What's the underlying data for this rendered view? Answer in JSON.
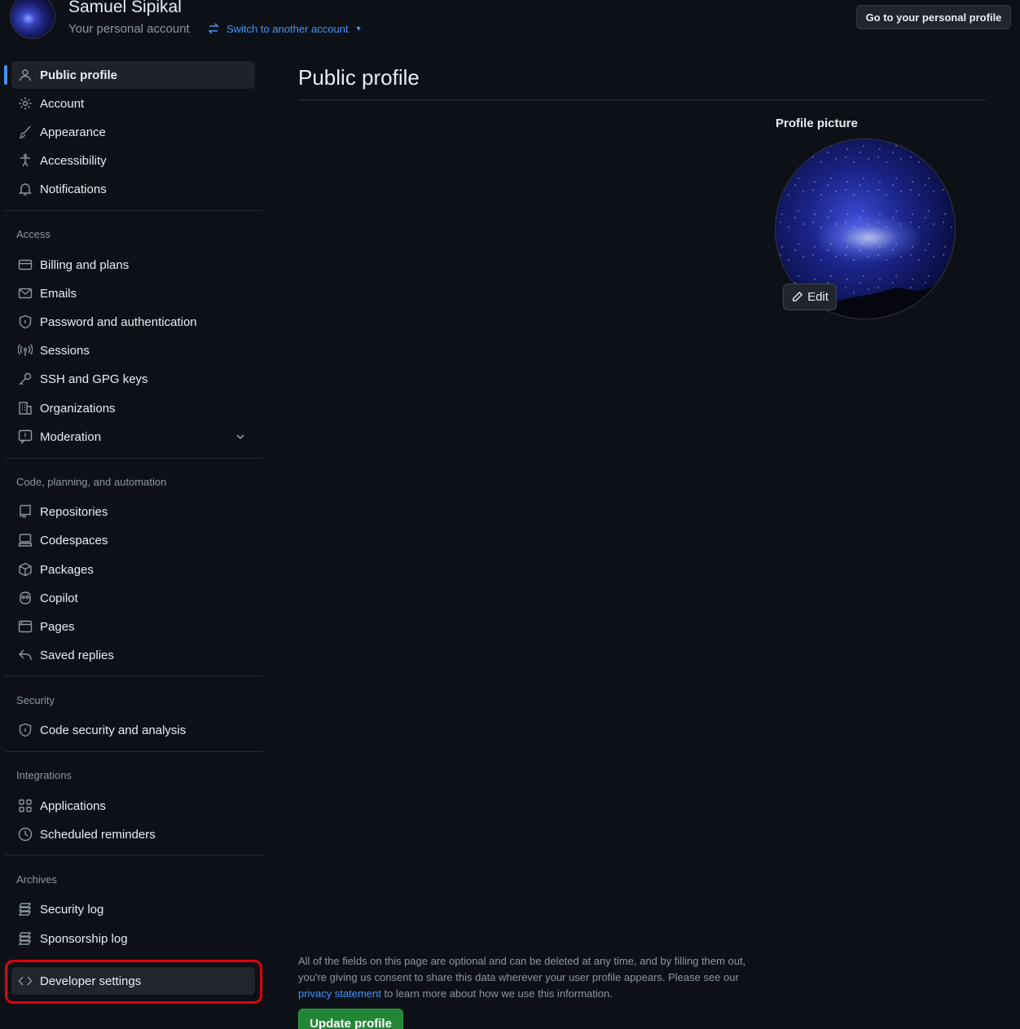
{
  "header": {
    "account_name": "Samuel Sipikal",
    "account_subtitle": "Your personal account",
    "switch_label": "Switch to another account",
    "go_profile_label": "Go to your personal profile"
  },
  "sidebar": {
    "top_items": [
      {
        "label": "Public profile",
        "icon": "person-icon",
        "active": true
      },
      {
        "label": "Account",
        "icon": "gear-icon"
      },
      {
        "label": "Appearance",
        "icon": "paintbrush-icon"
      },
      {
        "label": "Accessibility",
        "icon": "accessibility-icon"
      },
      {
        "label": "Notifications",
        "icon": "bell-icon"
      }
    ],
    "access_heading": "Access",
    "access_items": [
      {
        "label": "Billing and plans",
        "icon": "credit-card-icon"
      },
      {
        "label": "Emails",
        "icon": "mail-icon"
      },
      {
        "label": "Password and authentication",
        "icon": "shield-lock-icon"
      },
      {
        "label": "Sessions",
        "icon": "broadcast-icon"
      },
      {
        "label": "SSH and GPG keys",
        "icon": "key-icon"
      },
      {
        "label": "Organizations",
        "icon": "organization-icon"
      },
      {
        "label": "Moderation",
        "icon": "report-icon",
        "expandable": true
      }
    ],
    "code_heading": "Code, planning, and automation",
    "code_items": [
      {
        "label": "Repositories",
        "icon": "repo-icon"
      },
      {
        "label": "Codespaces",
        "icon": "codespaces-icon"
      },
      {
        "label": "Packages",
        "icon": "package-icon"
      },
      {
        "label": "Copilot",
        "icon": "copilot-icon"
      },
      {
        "label": "Pages",
        "icon": "browser-icon"
      },
      {
        "label": "Saved replies",
        "icon": "reply-icon"
      }
    ],
    "security_heading": "Security",
    "security_items": [
      {
        "label": "Code security and analysis",
        "icon": "shield-icon"
      }
    ],
    "integrations_heading": "Integrations",
    "integrations_items": [
      {
        "label": "Applications",
        "icon": "apps-icon"
      },
      {
        "label": "Scheduled reminders",
        "icon": "clock-icon"
      }
    ],
    "archives_heading": "Archives",
    "archives_items": [
      {
        "label": "Security log",
        "icon": "log-icon"
      },
      {
        "label": "Sponsorship log",
        "icon": "log-icon"
      }
    ],
    "developer_settings": {
      "label": "Developer settings",
      "icon": "code-icon"
    }
  },
  "main": {
    "title": "Public profile",
    "profile_picture_label": "Profile picture",
    "edit_label": "Edit",
    "notice_pre": "All of the fields on this page are optional and can be deleted at any time, and by filling them out, you're giving us consent to share this data wherever your user profile appears. Please see our ",
    "notice_link": "privacy statement",
    "notice_post": " to learn more about how we use this information.",
    "update_label": "Update profile"
  },
  "colors": {
    "background": "#0d1117",
    "accent": "#4493f8",
    "button_green": "#238636",
    "highlight_red": "#e0000e"
  }
}
